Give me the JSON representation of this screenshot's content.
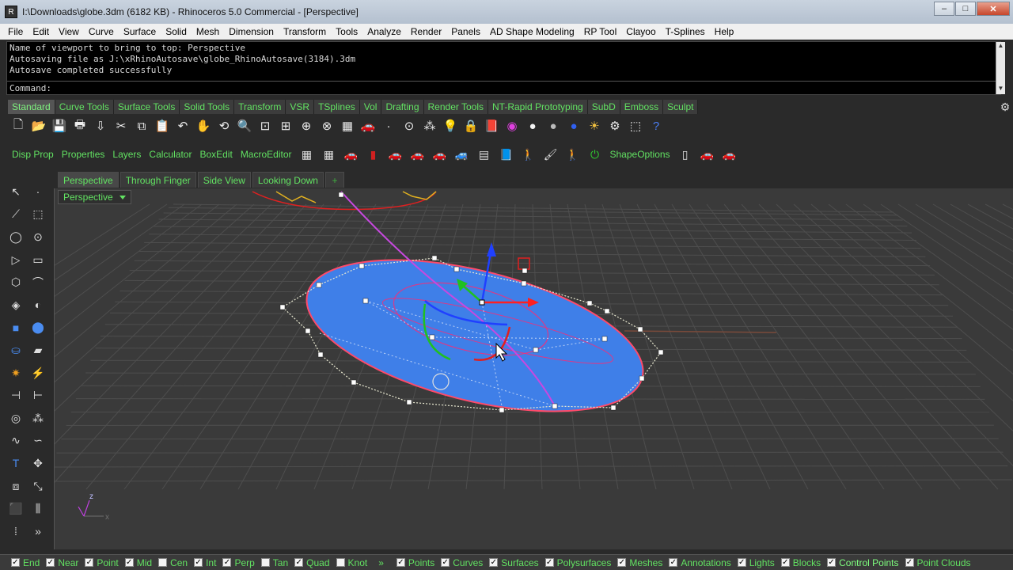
{
  "window": {
    "title": "I:\\Downloads\\globe.3dm (6182 KB) - Rhinoceros 5.0 Commercial - [Perspective]",
    "minimize_icon": "minimize-icon",
    "maximize_icon": "maximize-icon",
    "close_icon": "close-icon"
  },
  "menu": [
    "File",
    "Edit",
    "View",
    "Curve",
    "Surface",
    "Solid",
    "Mesh",
    "Dimension",
    "Transform",
    "Tools",
    "Analyze",
    "Render",
    "Panels",
    "AD Shape Modeling",
    "RP Tool",
    "Clayoo",
    "T-Splines",
    "Help"
  ],
  "command": {
    "history": [
      "Name of viewport to bring to top: Perspective",
      "Autosaving file as J:\\xRhinoAutosave\\globe_RhinoAutosave(3184).3dm",
      "Autosave completed successfully"
    ],
    "prompt": "Command:",
    "value": ""
  },
  "toolbar_tabs": [
    "Standard",
    "Curve Tools",
    "Surface Tools",
    "Solid Tools",
    "Transform",
    "VSR",
    "TSplines",
    "Vol",
    "Drafting",
    "Render Tools",
    "NT-Rapid Prototyping",
    "SubD",
    "Emboss",
    "Sculpt"
  ],
  "toolbar_tab_active": "Standard",
  "standard_tools": [
    "new-icon",
    "open-icon",
    "save-icon",
    "print-icon",
    "import-icon",
    "cut-icon",
    "copy-icon",
    "paste-icon",
    "undo-icon",
    "pan-icon",
    "rotate-view-icon",
    "zoom-icon",
    "zoom-window-icon",
    "zoom-extents-icon",
    "zoom-selected-icon",
    "zoom-all-icon",
    "four-viewports-icon",
    "car-icon",
    "point-icon",
    "target-icon",
    "layer-point-icon",
    "light-icon",
    "lock-icon",
    "render-icon",
    "color-wheel-icon",
    "sphere-white-icon",
    "sphere-gray-icon",
    "sphere-blue-icon",
    "sun-icon",
    "settings-gear-icon",
    "select-window-icon",
    "help-icon"
  ],
  "toolbar2": {
    "labels_left": [
      "Disp Prop",
      "Properties",
      "Layers",
      "Calculator",
      "BoxEdit",
      "MacroEditor"
    ],
    "icons": [
      "grid-icon",
      "grid-alt-icon",
      "car-red-icon",
      "cabinet-icon",
      "car-icon",
      "car-icon",
      "car-icon",
      "car-gray-icon",
      "table-icon",
      "book-icon",
      "person-icon",
      "brush-icon",
      "person-alt-icon",
      "power-icon"
    ],
    "label_right": "ShapeOptions",
    "icons_right": [
      "cabinet-alt-icon",
      "car-icon",
      "car-icon"
    ]
  },
  "left_tools": [
    [
      "select-arrow-icon",
      "point-icon"
    ],
    [
      "polyline-icon",
      "rectangle-select-icon"
    ],
    [
      "circle-icon",
      "ellipse-icon"
    ],
    [
      "polygon-icon",
      "rectangle-icon"
    ],
    [
      "hexagon-icon",
      "arc-icon"
    ],
    [
      "surface-icon",
      "sweep-icon"
    ],
    [
      "box-icon",
      "spheres-icon"
    ],
    [
      "cylinder-icon",
      "plane-icon"
    ],
    [
      "explode-icon",
      "lightning-icon"
    ],
    [
      "split-icon",
      "split-alt-icon"
    ],
    [
      "boolean-icon",
      "cluster-icon"
    ],
    [
      "curve-icon",
      "curve-alt-icon"
    ],
    [
      "text-icon",
      "move-icon"
    ],
    [
      "group-icon",
      "scale-icon"
    ],
    [
      "cube-icon",
      "array-icon"
    ],
    [
      "grid-dots-icon",
      "expand-icon"
    ]
  ],
  "viewport_tabs": [
    "Perspective",
    "Through Finger",
    "Side View",
    "Looking Down"
  ],
  "viewport_tab_active": "Perspective",
  "viewport_add_icon": "add-viewport-icon",
  "viewport": {
    "title": "Perspective",
    "axis_z": "z",
    "axis_x": "x",
    "colors": {
      "grid": "#4e4e4e",
      "globe_fill": "#3f7fe8",
      "globe_edge": "#ff4a6a",
      "control_points": "#ffffff",
      "gumball_z": "#2040ff",
      "gumball_y": "#20c020",
      "gumball_x": "#ff2020",
      "curve": "#c848e0"
    }
  },
  "status_osnaps": [
    {
      "label": "End",
      "checked": true
    },
    {
      "label": "Near",
      "checked": true
    },
    {
      "label": "Point",
      "checked": true
    },
    {
      "label": "Mid",
      "checked": true
    },
    {
      "label": "Cen",
      "checked": false
    },
    {
      "label": "Int",
      "checked": true
    },
    {
      "label": "Perp",
      "checked": true
    },
    {
      "label": "Tan",
      "checked": false
    },
    {
      "label": "Quad",
      "checked": true
    },
    {
      "label": "Knot",
      "checked": false
    }
  ],
  "status_more": "»",
  "status_filters": [
    {
      "label": "Points",
      "checked": true
    },
    {
      "label": "Curves",
      "checked": true
    },
    {
      "label": "Surfaces",
      "checked": true
    },
    {
      "label": "Polysurfaces",
      "checked": true
    },
    {
      "label": "Meshes",
      "checked": true
    },
    {
      "label": "Annotations",
      "checked": true
    },
    {
      "label": "Lights",
      "checked": true
    },
    {
      "label": "Blocks",
      "checked": true
    },
    {
      "label": "Control Points",
      "checked": true,
      "highlight": true
    },
    {
      "label": "Point Clouds",
      "checked": true
    }
  ]
}
